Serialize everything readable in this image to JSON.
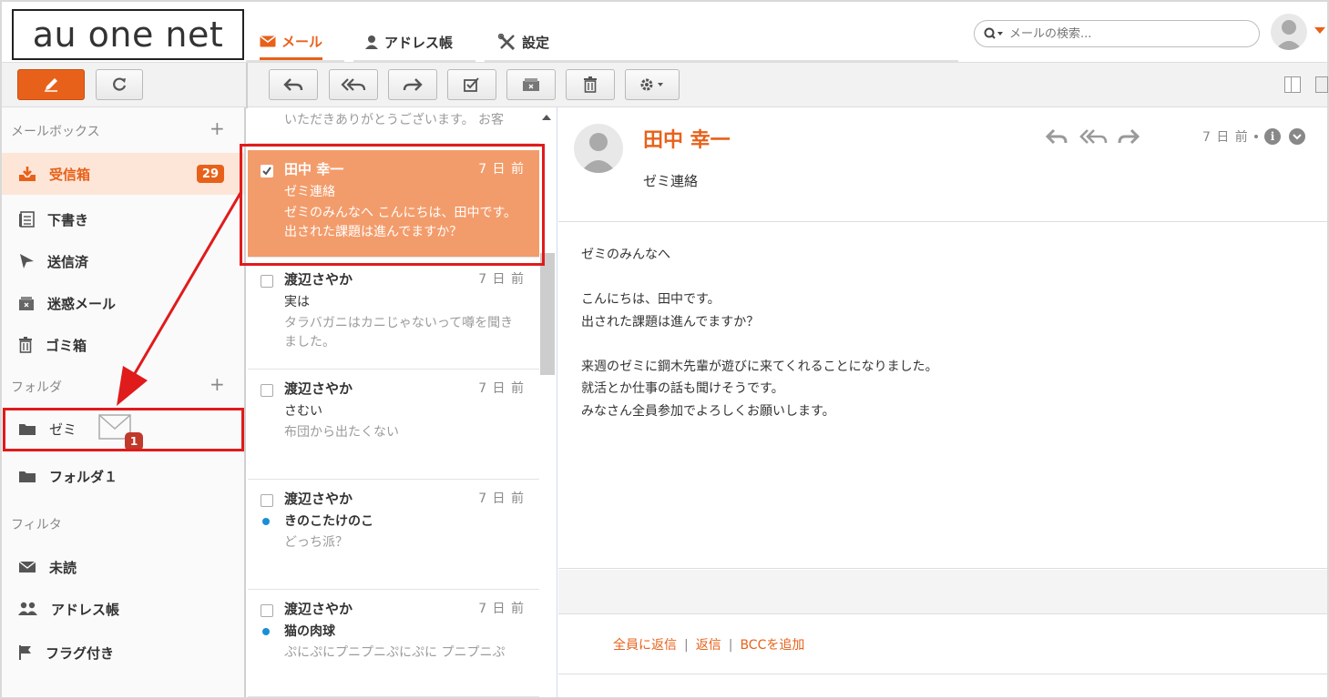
{
  "brand": {
    "logo_text": "au one net"
  },
  "nav": {
    "tabs": [
      {
        "label": "メール",
        "icon": "envelope-icon",
        "active": true
      },
      {
        "label": "アドレス帳",
        "icon": "person-icon",
        "active": false
      },
      {
        "label": "設定",
        "icon": "tools-icon",
        "active": false
      }
    ]
  },
  "search": {
    "placeholder": "メールの検索..."
  },
  "colors": {
    "accent": "#e8611a",
    "selected_row": "#f39c6b",
    "annotation": "#e01b1b",
    "unread_dot": "#1a8fd6"
  },
  "toolbar": {
    "buttons": [
      "compose-icon",
      "refresh-icon",
      "reply-icon",
      "reply-all-icon",
      "forward-icon",
      "mark-read-icon",
      "archive-icon",
      "trash-icon",
      "gear-icon"
    ]
  },
  "sidebar": {
    "mailbox_title": "メールボックス",
    "items": [
      {
        "label": "受信箱",
        "icon": "inbox-icon",
        "badge": "29"
      },
      {
        "label": "下書き",
        "icon": "drafts-icon"
      },
      {
        "label": "送信済",
        "icon": "sent-icon"
      },
      {
        "label": "迷惑メール",
        "icon": "spam-icon"
      },
      {
        "label": "ゴミ箱",
        "icon": "trash-icon"
      }
    ],
    "folder_title": "フォルダ",
    "folders": [
      {
        "label": "ゼミ",
        "drag_badge": "1"
      },
      {
        "label": "フォルダ１"
      }
    ],
    "filter_title": "フィルタ",
    "filters": [
      {
        "label": "未読",
        "icon": "envelope-icon"
      },
      {
        "label": "アドレス帳",
        "icon": "people-icon"
      },
      {
        "label": "フラグ付き",
        "icon": "flag-icon"
      }
    ]
  },
  "messages": {
    "top_partial": "いただきありがとうございます。 お客",
    "items": [
      {
        "sender": "田中 幸一",
        "date": "7 日 前",
        "subject": "ゼミ連絡",
        "preview": "ゼミのみんなへ こんにちは、田中です。 出された課題は進んでますか？"
      },
      {
        "sender": "渡辺さやか",
        "date": "7 日 前",
        "subject": "実は",
        "preview": "タラバガニはカニじゃないって噂を聞きました。"
      },
      {
        "sender": "渡辺さやか",
        "date": "7 日 前",
        "subject": "さむい",
        "preview": "布団から出たくない"
      },
      {
        "sender": "渡辺さやか",
        "date": "7 日 前",
        "subject": "きのこたけのこ",
        "preview": "どっち派？"
      },
      {
        "sender": "渡辺さやか",
        "date": "7 日 前",
        "subject": "猫の肉球",
        "preview": "ぷにぷにプニプニぷにぷに プニプニぷ"
      }
    ]
  },
  "reader": {
    "sender": "田中 幸一",
    "subject": "ゼミ連絡",
    "date": "7 日 前",
    "body": [
      "ゼミのみんなへ",
      "",
      "こんにちは、田中です。",
      "出された課題は進んでますか？",
      "",
      "来週のゼミに鋼木先輩が遊びに来てくれることになりました。",
      "就活とか仕事の話も聞けそうです。",
      "みなさん全員参加でよろしくお願いします。"
    ],
    "links": {
      "reply_all": "全員に返信",
      "reply": "返信",
      "add_bcc": "BCCを追加",
      "separator": "|"
    }
  }
}
